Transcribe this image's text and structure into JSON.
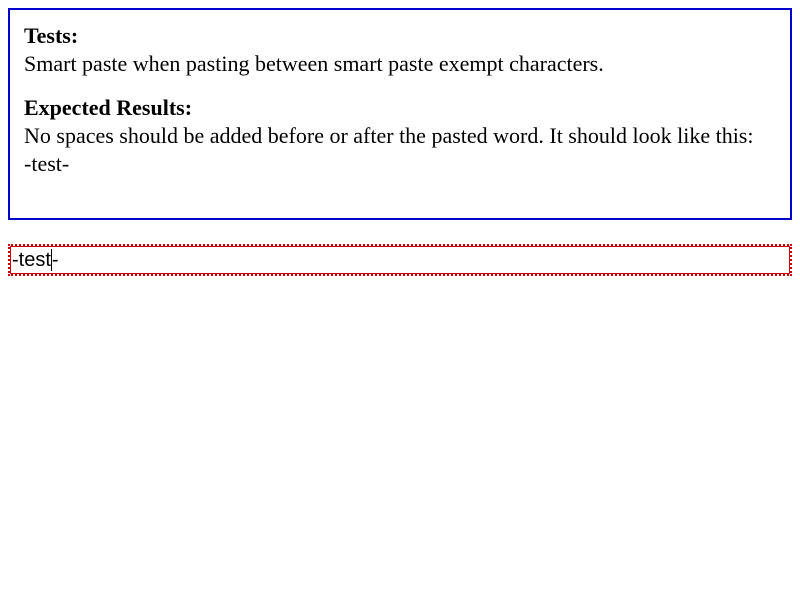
{
  "test": {
    "tests_heading": "Tests:",
    "tests_text": "Smart paste when pasting between smart paste exempt characters.",
    "expected_heading": "Expected Results:",
    "expected_text": "No spaces should be added before or after the pasted word. It should look like this:",
    "expected_example": "-test-"
  },
  "editor": {
    "prefix": "-",
    "word": "test",
    "suffix": "-"
  },
  "colors": {
    "description_border": "#0000cc",
    "editor_border": "#cc0000"
  }
}
